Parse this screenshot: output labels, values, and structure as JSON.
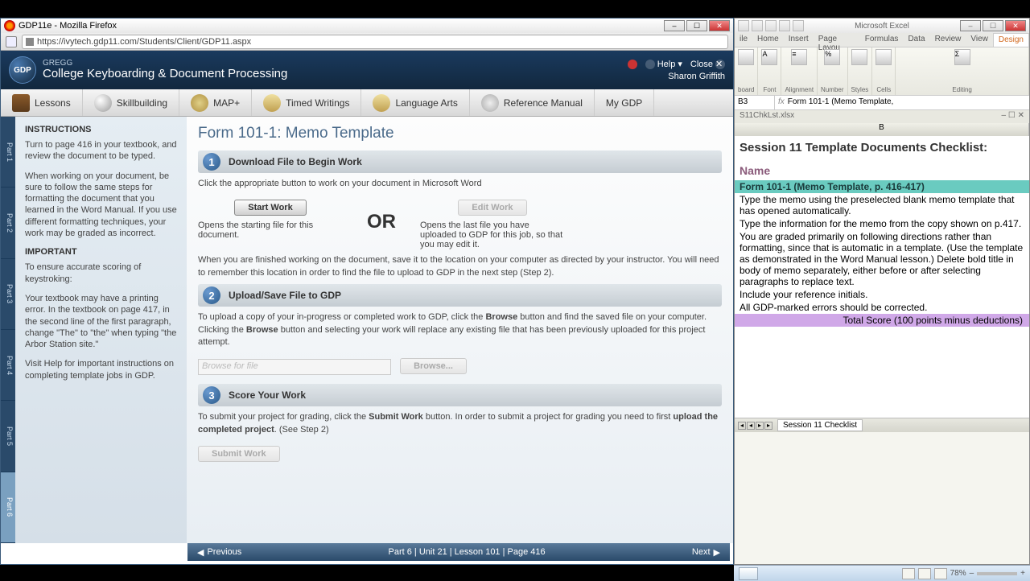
{
  "firefox": {
    "title": "GDP11e - Mozilla Firefox",
    "url": "https://ivytech.gdp11.com/Students/Client/GDP11.aspx"
  },
  "gdp": {
    "subtitle": "GREGG",
    "title": "College Keyboarding & Document Processing",
    "help": "Help",
    "close": "Close",
    "user": "Sharon Griffith",
    "nav": {
      "lessons": "Lessons",
      "skillbuilding": "Skillbuilding",
      "map": "MAP+",
      "timed": "Timed Writings",
      "langarts": "Language Arts",
      "refman": "Reference Manual",
      "mygdp": "My GDP"
    },
    "side_tabs": [
      "Part 1",
      "Part 2",
      "Part 3",
      "Part 4",
      "Part 5",
      "Part 6"
    ],
    "instructions": {
      "heading": "INSTRUCTIONS",
      "p1": "Turn to page 416 in your textbook, and review the document to be typed.",
      "p2": "When working on your document, be sure to follow the same steps for formatting the document that you learned in the Word Manual. If you use different formatting techniques, your work may be graded as incorrect.",
      "heading2": "IMPORTANT",
      "p3": "To ensure accurate scoring of keystroking:",
      "p4": "Your textbook may have a printing error. In the textbook on page 417, in the second line of the first paragraph, change \"The\" to \"the\" when typing \"the Arbor Station site.\"",
      "p5": "Visit Help for important instructions on completing template jobs in GDP."
    },
    "main": {
      "page_title": "Form 101-1: Memo Template",
      "step1": {
        "num": "1",
        "title": "Download File to Begin Work"
      },
      "click_line": "Click the appropriate button to work on your document in Microsoft Word",
      "start_btn": "Start Work",
      "edit_btn": "Edit Work",
      "or_word": "OR",
      "start_desc": "Opens the starting file for this document.",
      "edit_desc": "Opens the last file you have uploaded to GDP for this job, so that you may edit it.",
      "finish_para_a": "When you are finished working on the document, save it to the location on your computer as directed by your instructor. You will need to remember this location in order to find the file to upload to GDP in the next step (Step 2).",
      "step2": {
        "num": "2",
        "title": "Upload/Save File to GDP"
      },
      "upload_para_a": "To upload a copy of your in-progress or completed work to GDP, click the ",
      "browse_word": "Browse",
      "upload_para_b": " button and find the saved file on your computer. Clicking the ",
      "upload_para_c": " button and selecting your work will replace any existing file that has been previously uploaded for this project attempt.",
      "file_placeholder": "Browse for file",
      "browse_btn": "Browse...",
      "step3": {
        "num": "3",
        "title": "Score Your Work"
      },
      "score_para_a": "To submit your project for grading, click the ",
      "submit_word": "Submit Work",
      "score_para_b": " button. In order to submit a project for grading you need to first ",
      "upload_bold": "upload the completed project",
      "score_para_c": ". (See Step 2)",
      "submit_btn": "Submit Work"
    },
    "footer": {
      "prev": "Previous",
      "center": "Part 6  |  Unit 21  |  Lesson 101  |  Page 416",
      "next": "Next"
    }
  },
  "excel": {
    "app_title": "Microsoft Excel",
    "tabs": [
      "ile",
      "Home",
      "Insert",
      "Page Layou",
      "Formulas",
      "Data",
      "Review",
      "View",
      "Design"
    ],
    "ribbon_groups": [
      "board",
      "Font",
      "Alignment",
      "Number",
      "Styles",
      "Cells",
      "Editing"
    ],
    "cell_ref": "B3",
    "formula": "Form 101-1 (Memo Template,",
    "doc_name": "S11ChkLst.xlsx",
    "col_header": "B",
    "rows": {
      "title": "Session 11 Template Documents Checklist:",
      "name": "Name",
      "band": "Form 101-1 (Memo Template, p. 416-417)",
      "r1": "Type the memo using the preselected blank memo template that has opened automatically.",
      "r2": "Type the information for the memo from the copy shown on p.417.",
      "r3": "You are graded primarily on following directions rather than formatting, since that is automatic in a template. (Use the template as demonstrated in the Word Manual lesson.) Delete bold title in body of memo separately, either before or after selecting paragraphs to replace text.",
      "r4": "Include your reference initials.",
      "r5": "All GDP-marked errors should be corrected.",
      "total": "Total Score    (100 points minus deductions)"
    },
    "sheet_tab": "Session 11 Checklist",
    "zoom": "78%"
  }
}
